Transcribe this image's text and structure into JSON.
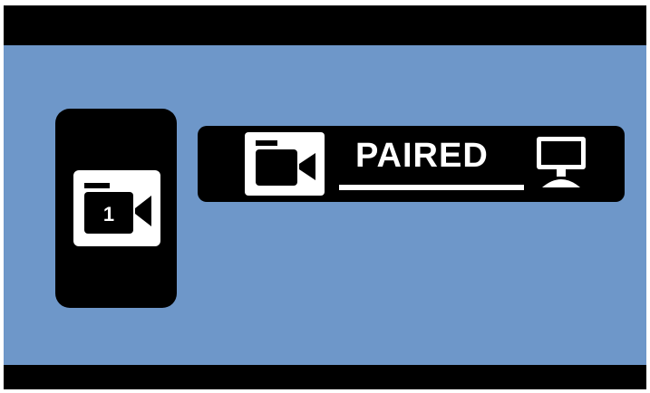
{
  "camera_card": {
    "number": "1",
    "icon": "video-camera-icon"
  },
  "pairing": {
    "status_label": "PAIRED",
    "source_icon": "video-camera-icon",
    "target_icon": "monitor-icon"
  },
  "colors": {
    "background": "#6e97c9",
    "panel": "#000000",
    "icon_fg": "#ffffff"
  }
}
